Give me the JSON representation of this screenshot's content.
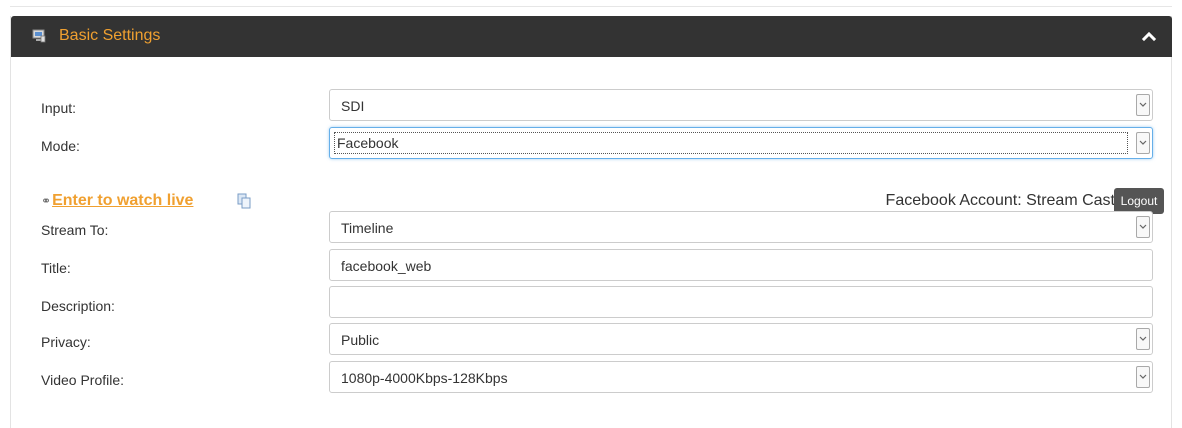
{
  "panel": {
    "title": "Basic Settings",
    "header_icon": "monitor-settings-icon",
    "collapse_icon": "chevron-up-icon",
    "accent_color": "#f0a030",
    "header_bg": "#333333"
  },
  "fields": {
    "input": {
      "label": "Input:",
      "value": "SDI"
    },
    "mode": {
      "label": "Mode:",
      "value": "Facebook"
    },
    "stream_to": {
      "label": "Stream To:",
      "value": "Timeline"
    },
    "title": {
      "label": "Title:",
      "value": "facebook_web"
    },
    "description": {
      "label": "Description:",
      "value": ""
    },
    "privacy": {
      "label": "Privacy:",
      "value": "Public"
    },
    "video_profile": {
      "label": "Video Profile:",
      "value": "1080p-4000Kbps-128Kbps"
    }
  },
  "watch_live": {
    "link_icon": "link-icon",
    "label": "Enter to watch live",
    "copy_icon": "copy-icon"
  },
  "account": {
    "text": "Facebook Account: Stream Cast",
    "logout_label": "Logout"
  }
}
